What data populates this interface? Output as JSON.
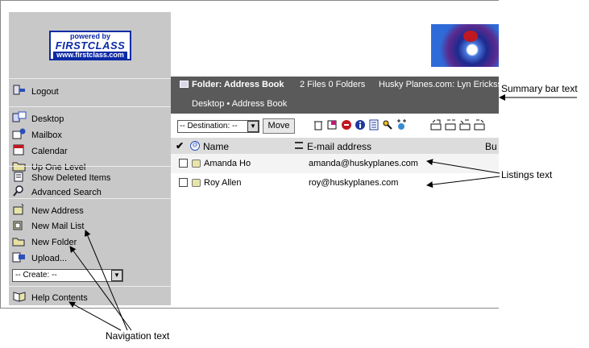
{
  "logo": {
    "line1": "powered by",
    "line2": "FIRSTCLASS",
    "line3": "www.firstclass.com"
  },
  "sidebar": {
    "groups": [
      [
        {
          "label": "Logout",
          "icon": "logout-icon"
        }
      ],
      [
        {
          "label": "Desktop",
          "icon": "desktop-icon"
        },
        {
          "label": "Mailbox",
          "icon": "mailbox-icon"
        },
        {
          "label": "Calendar",
          "icon": "calendar-icon"
        },
        {
          "label": "Up One Level",
          "icon": "up-folder-icon"
        }
      ],
      [
        {
          "label": "Show Deleted Items",
          "icon": "trash-list-icon"
        },
        {
          "label": "Advanced Search",
          "icon": "magnifier-icon"
        }
      ],
      [
        {
          "label": "New Address",
          "icon": "new-address-icon"
        },
        {
          "label": "New Mail List",
          "icon": "new-mail-list-icon"
        },
        {
          "label": "New Folder",
          "icon": "new-folder-icon"
        },
        {
          "label": "Upload...",
          "icon": "upload-icon"
        }
      ],
      [
        {
          "label": "Help Contents",
          "icon": "help-icon"
        }
      ]
    ],
    "create_select": "-- Create: --"
  },
  "summary": {
    "folder_title": "Folder: Address Book",
    "counts": "2 Files  0 Folders",
    "server_user": "Husky Planes.com: Lyn Ericksson",
    "breadcrumb": "Desktop • Address Book"
  },
  "toolbar": {
    "destination": "-- Destination: --",
    "move_label": "Move",
    "tools": [
      "trash-icon",
      "flag-icon",
      "stop-icon",
      "info-icon",
      "list-icon",
      "key-icon",
      "add-member-icon",
      "mail-out-icon",
      "mail-in-icon",
      "reply-icon",
      "forward-icon"
    ]
  },
  "columns": {
    "check": "✔",
    "name": "Name",
    "email": "E-mail address",
    "extra": "Bu"
  },
  "rows": [
    {
      "name": "Amanda Ho",
      "email": "amanda@huskyplanes.com"
    },
    {
      "name": "Roy Allen",
      "email": "roy@huskyplanes.com"
    }
  ],
  "annotations": {
    "summary": "Summary bar text",
    "listings": "Listings text",
    "navigation": "Navigation text"
  },
  "colors": {
    "sidebar": "#c8c8c8",
    "summary_bar": "#5a5a5a",
    "column_header": "#dcdcdc",
    "brand_blue": "#0c2aa5"
  }
}
